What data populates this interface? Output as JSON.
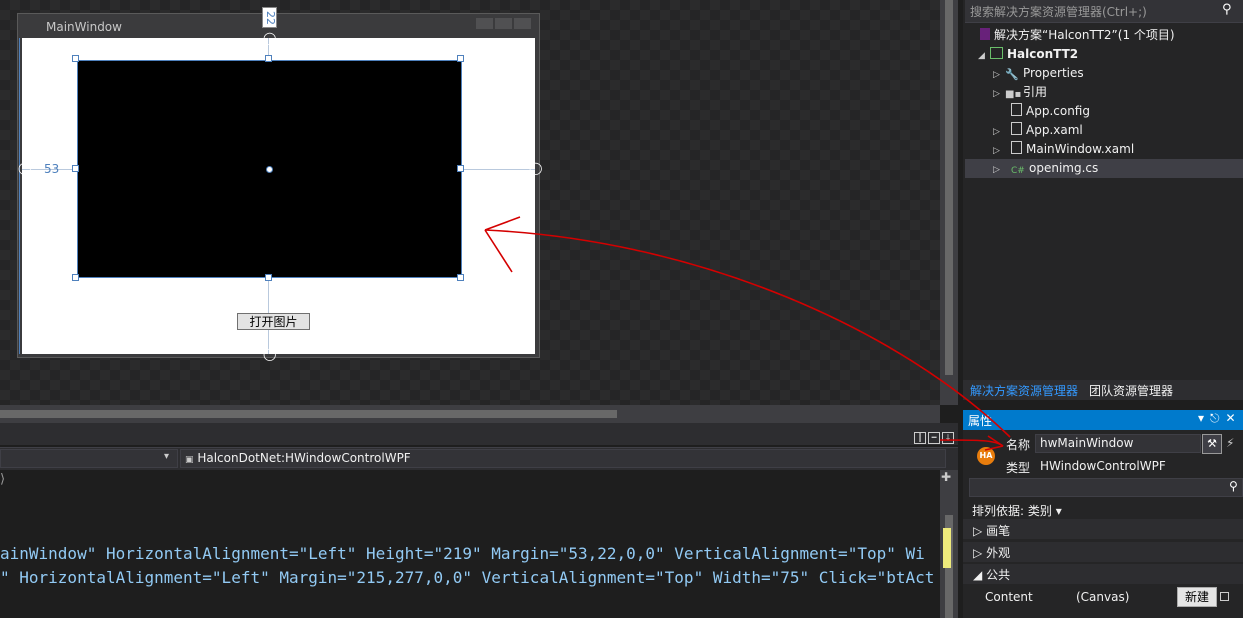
{
  "designer": {
    "window_title": "MainWindow",
    "margin_left_value": "53",
    "margin_top_value": "22",
    "open_button_label": "打开图片"
  },
  "solution_explorer": {
    "search_placeholder": "搜索解决方案资源管理器(Ctrl+;)",
    "items": [
      {
        "label": "解决方案“HalconTT2”(1 个项目)"
      },
      {
        "label": "HalconTT2"
      },
      {
        "label": "Properties"
      },
      {
        "label": "引用"
      },
      {
        "label": "App.config"
      },
      {
        "label": "App.xaml"
      },
      {
        "label": "MainWindow.xaml"
      },
      {
        "label": "openimg.cs"
      }
    ],
    "tabs": [
      {
        "label": "解决方案资源管理器"
      },
      {
        "label": "团队资源管理器"
      }
    ]
  },
  "properties": {
    "title": "属性",
    "name_label": "名称",
    "name_value": "hwMainWindow",
    "type_label": "类型",
    "type_value": "HWindowControlWPF",
    "icon_text": "HA",
    "sort_label": "排列依据: 类别",
    "categories": [
      {
        "label": "画笔"
      },
      {
        "label": "外观"
      },
      {
        "label": "公共"
      }
    ],
    "content_label": "Content",
    "content_value": "(Canvas)",
    "new_button_label": "新建"
  },
  "editor": {
    "nav_right": "HalconDotNet:HWindowControlWPF",
    "code_lines": [
      "ainWindow\" HorizontalAlignment=\"Left\" Height=\"219\" Margin=\"53,22,0,0\" VerticalAlignment=\"Top\" Wi",
      "\" HorizontalAlignment=\"Left\" Margin=\"215,277,0,0\" VerticalAlignment=\"Top\" Width=\"75\" Click=\"btAct"
    ]
  },
  "colors": {
    "accent": "#007acc",
    "annotation_red": "#d40000"
  }
}
